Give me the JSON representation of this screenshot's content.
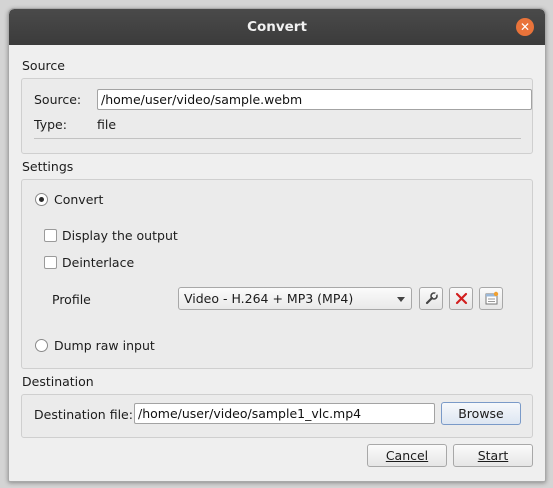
{
  "window": {
    "title": "Convert"
  },
  "source": {
    "section_label": "Source",
    "source_label": "Source:",
    "source_value": "/home/user/video/sample.webm",
    "type_label": "Type:",
    "type_value": "file"
  },
  "settings": {
    "section_label": "Settings",
    "convert_label": "Convert",
    "convert_selected": true,
    "display_output_label": "Display the output",
    "display_output_checked": false,
    "deinterlace_label": "Deinterlace",
    "deinterlace_checked": false,
    "profile_label": "Profile",
    "profile_selected": "Video - H.264 + MP3 (MP4)",
    "dump_raw_label": "Dump raw input",
    "dump_raw_selected": false
  },
  "destination": {
    "section_label": "Destination",
    "file_label": "Destination file:",
    "file_value": "/home/user/video/sample1_vlc.mp4",
    "browse_label": "Browse"
  },
  "footer": {
    "cancel_label": "Cancel",
    "start_label": "Start"
  },
  "icons": {
    "close": "close-icon",
    "edit_profile": "wrench-icon",
    "delete_profile": "delete-x-icon",
    "new_profile": "new-profile-icon"
  },
  "colors": {
    "titlebar": "#3f3f3f",
    "close_button": "#e9733a",
    "delete_icon": "#d21f1f"
  }
}
